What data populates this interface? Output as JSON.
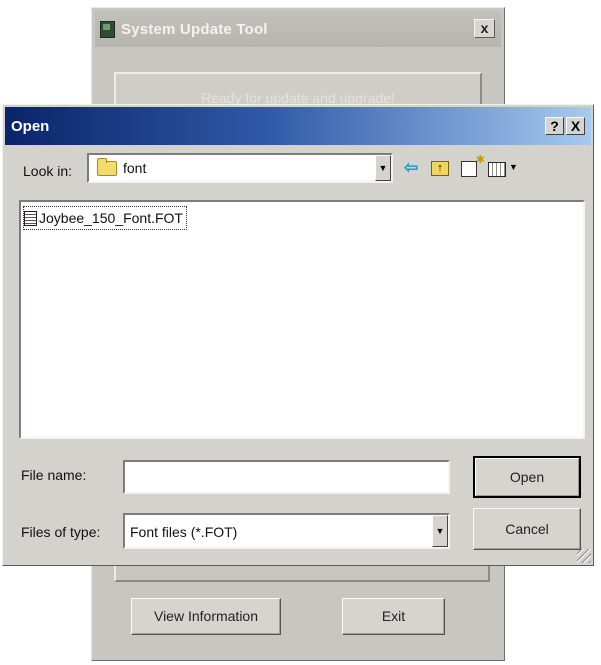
{
  "background_window": {
    "title": "System Update Tool",
    "close_symbol": "x",
    "status_text": "Ready for update and upgrade!",
    "view_information_label": "View Information",
    "exit_label": "Exit"
  },
  "open_dialog": {
    "title": "Open",
    "help_symbol": "?",
    "close_symbol": "X",
    "look_in_label": "Look in:",
    "look_in_value": "font",
    "files": [
      {
        "name": "Joybee_150_Font.FOT",
        "icon": "document-icon"
      }
    ],
    "file_name_label": "File name:",
    "file_name_value": "",
    "files_of_type_label": "Files of type:",
    "files_of_type_value": "Font files (*.FOT)",
    "open_label": "Open",
    "cancel_label": "Cancel",
    "toolbar_icons": [
      "back-icon",
      "up-folder-icon",
      "new-folder-icon",
      "views-menu-icon"
    ]
  },
  "colors": {
    "title_gradient_start": "#0a246a",
    "title_gradient_end": "#a6caf0",
    "dialog_face": "#d4d2cd"
  }
}
